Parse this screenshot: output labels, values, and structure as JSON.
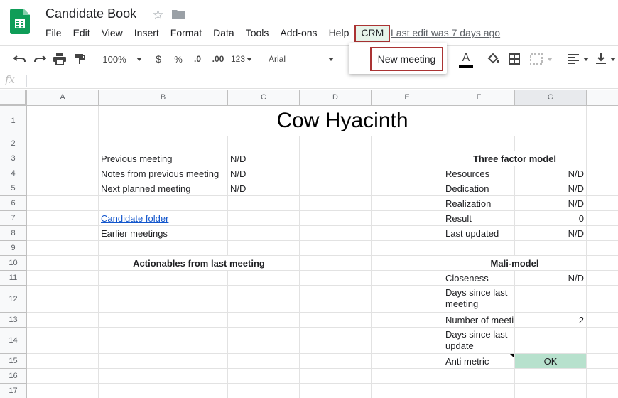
{
  "doc": {
    "title": "Candidate Book",
    "last_edit": "Last edit was 7 days ago"
  },
  "menu": [
    "File",
    "Edit",
    "View",
    "Insert",
    "Format",
    "Data",
    "Tools",
    "Add-ons",
    "Help"
  ],
  "crm_menu": {
    "label": "CRM",
    "item": "New meeting"
  },
  "toolbar": {
    "zoom": "100%",
    "currency": "$",
    "percent": "%",
    "dec_less": ".0",
    "dec_more": ".00",
    "format": "123",
    "font": "Arial",
    "text_color_glyph": "A"
  },
  "formula_bar": {
    "fx": "fx"
  },
  "columns": [
    "A",
    "B",
    "C",
    "D",
    "E",
    "F",
    "G"
  ],
  "rows": [
    "1",
    "2",
    "3",
    "4",
    "5",
    "6",
    "7",
    "8",
    "9",
    "10",
    "11",
    "12",
    "13",
    "14",
    "15",
    "16",
    "17"
  ],
  "sheet": {
    "title": "Cow Hyacinth",
    "b3": "Previous meeting",
    "c3": "N/D",
    "b4": "Notes from previous meeting",
    "c4": "N/D",
    "b5": "Next planned meeting",
    "c5": "N/D",
    "b7": "Candidate folder",
    "b8": "Earlier meetings",
    "b10": "Actionables from last meeting",
    "f3": "Three factor model",
    "f4": "Resources",
    "g4": "N/D",
    "f5": "Dedication",
    "g5": "N/D",
    "f6": "Realization",
    "g6": "N/D",
    "f7": "Result",
    "g7": "0",
    "f8": "Last updated",
    "g8": "N/D",
    "f10": "Mali-model",
    "f11": "Closeness",
    "g11": "N/D",
    "f12": "Days since last meeting",
    "f13": "Number of meeti",
    "g13": "2",
    "f14": "Days since last update",
    "f15": "Anti metric",
    "g15": "OK"
  },
  "colors": {
    "ok_fill": "#b7e1cd",
    "crm_bg": "#e6f4ea",
    "highlight_border": "#aa3333",
    "link": "#1155cc",
    "logo_green": "#0f9d58"
  }
}
